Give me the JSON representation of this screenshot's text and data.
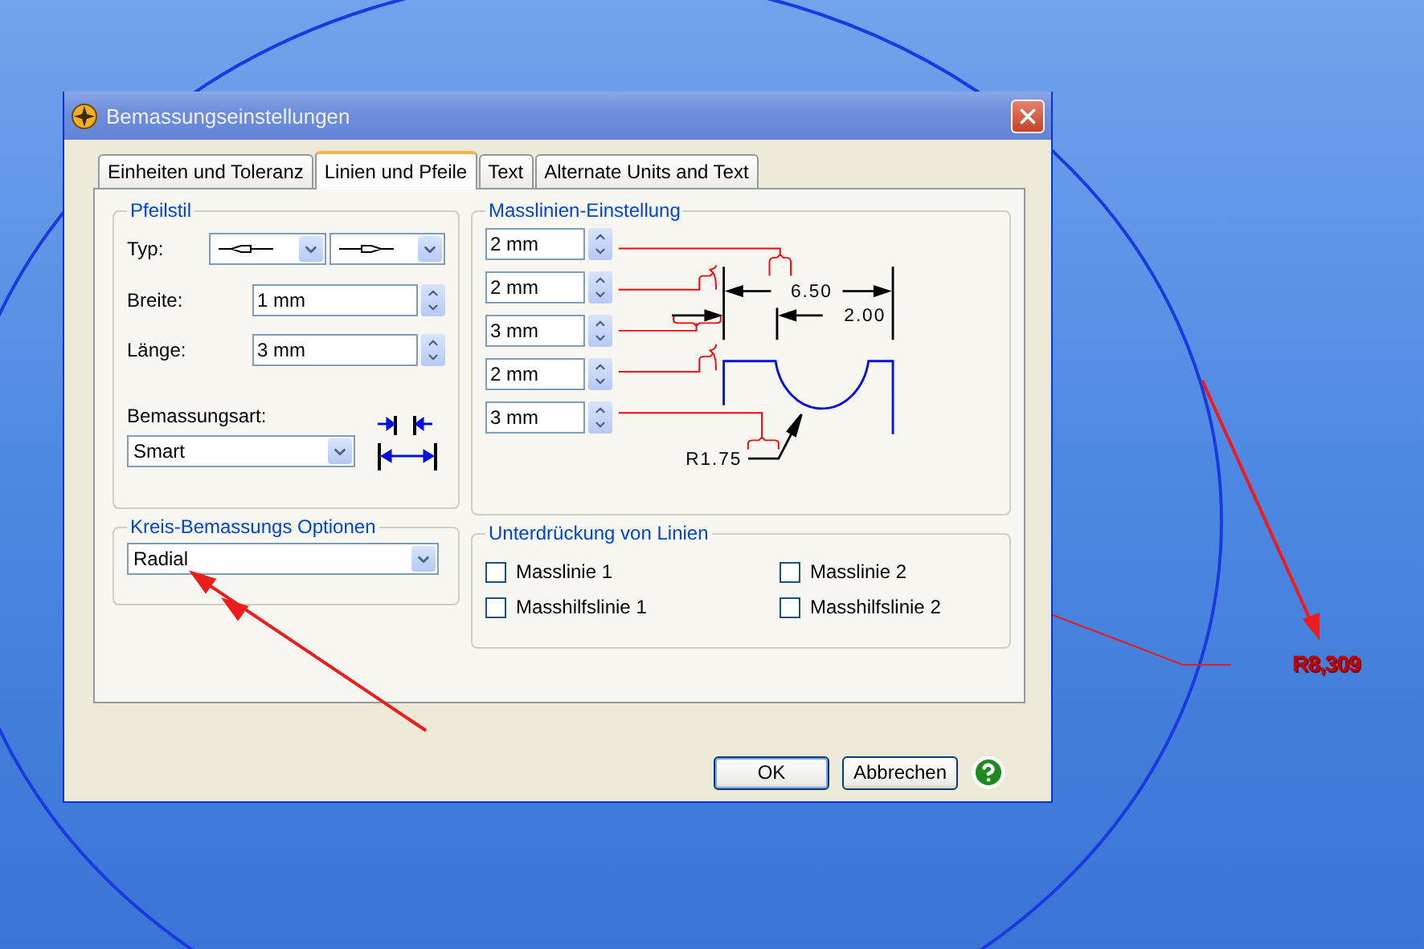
{
  "window": {
    "title": "Bemassungseinstellungen"
  },
  "tabs": [
    {
      "label": "Einheiten und Toleranz",
      "selected": false
    },
    {
      "label": "Linien und Pfeile",
      "selected": true
    },
    {
      "label": "Text",
      "selected": false
    },
    {
      "label": "Alternate Units and Text",
      "selected": false
    }
  ],
  "arrow_style": {
    "title": "Pfeilstil",
    "type_label": "Typ:",
    "width_label": "Breite:",
    "width_value": "1 mm",
    "length_label": "Länge:",
    "length_value": "3 mm",
    "mode_label": "Bemassungsart:",
    "mode_value": "Smart"
  },
  "circle_options": {
    "title": "Kreis-Bemassungs Optionen",
    "value": "Radial"
  },
  "dimension_lines": {
    "title": "Masslinien-Einstellung",
    "values": [
      "2 mm",
      "2 mm",
      "3 mm",
      "2 mm",
      "3 mm"
    ],
    "diagram_labels": [
      "6.50",
      "2.00",
      "R1.75"
    ]
  },
  "suppression": {
    "title": "Unterdrückung von Linien",
    "options": [
      {
        "label": "Masslinie 1",
        "checked": false
      },
      {
        "label": "Masslinie 2",
        "checked": false
      },
      {
        "label": "Masshilfslinie 1",
        "checked": false
      },
      {
        "label": "Masshilfslinie 2",
        "checked": false
      }
    ]
  },
  "buttons": [
    {
      "label": "OK",
      "default": true
    },
    {
      "label": "Abbrechen",
      "default": false
    }
  ],
  "canvas": {
    "dimension_label": "R8,309"
  }
}
